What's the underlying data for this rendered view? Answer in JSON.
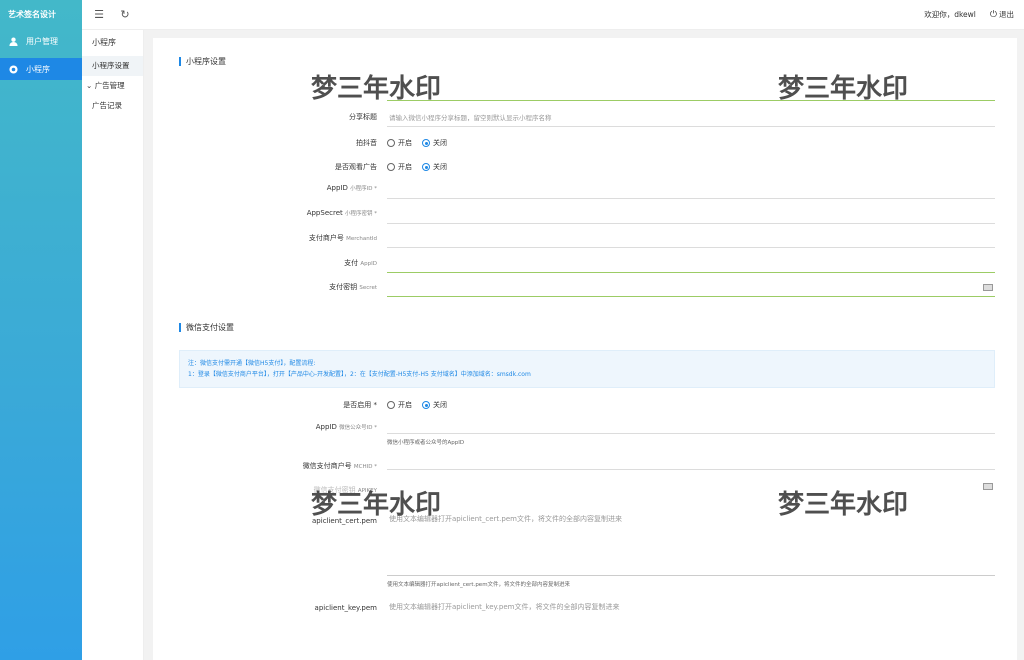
{
  "app": {
    "title": "艺术签名设计"
  },
  "sidebar": {
    "items": [
      {
        "label": "用户管理",
        "icon": "user-icon"
      },
      {
        "label": "小程序",
        "icon": "miniapp-icon"
      }
    ]
  },
  "subnav": {
    "title": "小程序",
    "items": [
      {
        "label": "小程序设置"
      },
      {
        "label": "广告管理"
      },
      {
        "label": "广告记录"
      }
    ]
  },
  "topbar": {
    "welcome": "欢迎你，",
    "user": "dkewl",
    "logout": "退出"
  },
  "section1": {
    "title": "小程序设置"
  },
  "form1": {
    "name_placeholder": "",
    "share_label": "分享标题",
    "share_placeholder": "请输入微信小程序分享标题，留空则默认显示小程序名称",
    "douyin_label": "拍抖音",
    "on": "开启",
    "off": "关闭",
    "ad_label": "是否观看广告",
    "appid_label": "AppID",
    "appid_sub": "小程序ID *",
    "secret_label": "AppSecret",
    "secret_sub": "小程序密钥 *",
    "merchant_label": "支付商户号",
    "merchant_sub": "MerchantId",
    "payappid_label": "支付",
    "payappid_sub": "AppID",
    "paysecret_label": "支付密钥",
    "paysecret_sub": "Secret"
  },
  "section2": {
    "title": "微信支付设置"
  },
  "note": {
    "line1": "注：微信支付需开通【微信H5支付】，配置流程:",
    "line2": "1：登录【微信支付商户平台】，打开【产品中心-开发配置】，2：在【支付配置-H5支付-H5 支付域名】中添加域名：smsdk.com"
  },
  "form2": {
    "enable_label": "是否启用 *",
    "on": "开启",
    "off": "关闭",
    "appid_label": "AppID",
    "appid_sub": "微信公众号ID *",
    "appid_hint": "微信小程序或者公众号的AppID",
    "mch_label": "微信支付商户号",
    "mch_sub": "MCHID *",
    "key_label": "微信支付密钥",
    "key_sub": "APIKEY",
    "cert_label": "apiclient_cert.pem",
    "cert_placeholder": "使用文本编辑器打开apiclient_cert.pem文件，将文件的全部内容复制进来",
    "cert_hint": "使用文本编辑器打开apiclient_cert.pem文件，将文件的全部内容复制进来",
    "keypem_label": "apiclient_key.pem",
    "keypem_placeholder": "使用文本编辑器打开apiclient_key.pem文件，将文件的全部内容复制进来"
  },
  "watermark": {
    "text": "梦三年水印"
  }
}
